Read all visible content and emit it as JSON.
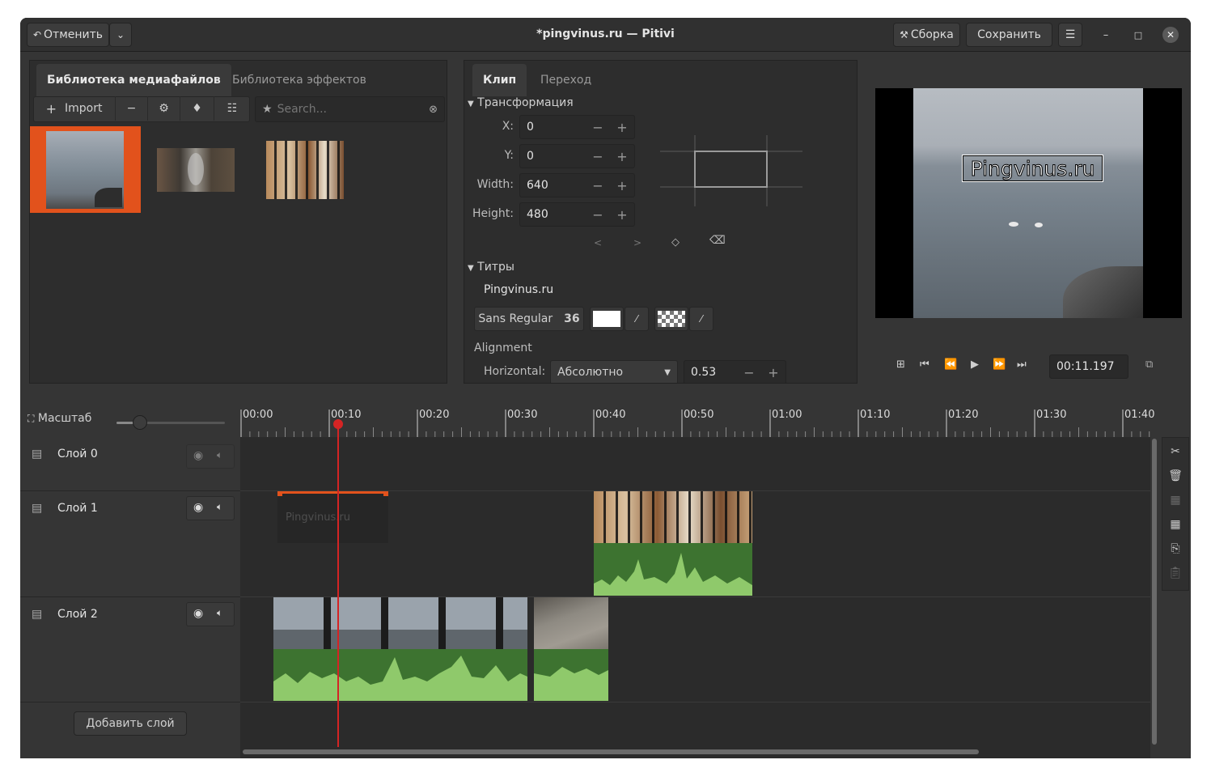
{
  "header": {
    "undo_label": "Отменить",
    "title": "*pingvinus.ru — Pitivi",
    "render_label": "Сборка",
    "save_label": "Сохранить"
  },
  "media_library": {
    "tabs": [
      "Библиотека медиафайлов",
      "Библиотека эффектов"
    ],
    "import_label": "Import",
    "search_placeholder": "Search..."
  },
  "clip_panel": {
    "tabs": [
      "Клип",
      "Переход"
    ],
    "transform_header": "Трансформация",
    "fields": [
      {
        "label": "X:",
        "value": "0"
      },
      {
        "label": "Y:",
        "value": "0"
      },
      {
        "label": "Width:",
        "value": "640"
      },
      {
        "label": "Height:",
        "value": "480"
      }
    ],
    "titles_header": "Титры",
    "title_text": "Pingvinus.ru",
    "font_name": "Sans Regular",
    "font_size": "36",
    "alignment_label": "Alignment",
    "horizontal_label": "Horizontal:",
    "horizontal_value": "Абсолютно",
    "horizontal_number": "0.53"
  },
  "viewer": {
    "overlay_text": "Pingvinus.ru",
    "timecode": "00:11.197"
  },
  "timeline": {
    "zoom_label": "Масштаб",
    "ruler_labels": [
      "00:00",
      "00:10",
      "00:20",
      "00:30",
      "00:40",
      "00:50",
      "01:00",
      "01:10",
      "01:20",
      "01:30",
      "01:40"
    ],
    "layers": [
      "Слой 0",
      "Слой 1",
      "Слой 2"
    ],
    "title_clip_text": "Pingvinus.ru",
    "add_layer_label": "Добавить слой"
  }
}
